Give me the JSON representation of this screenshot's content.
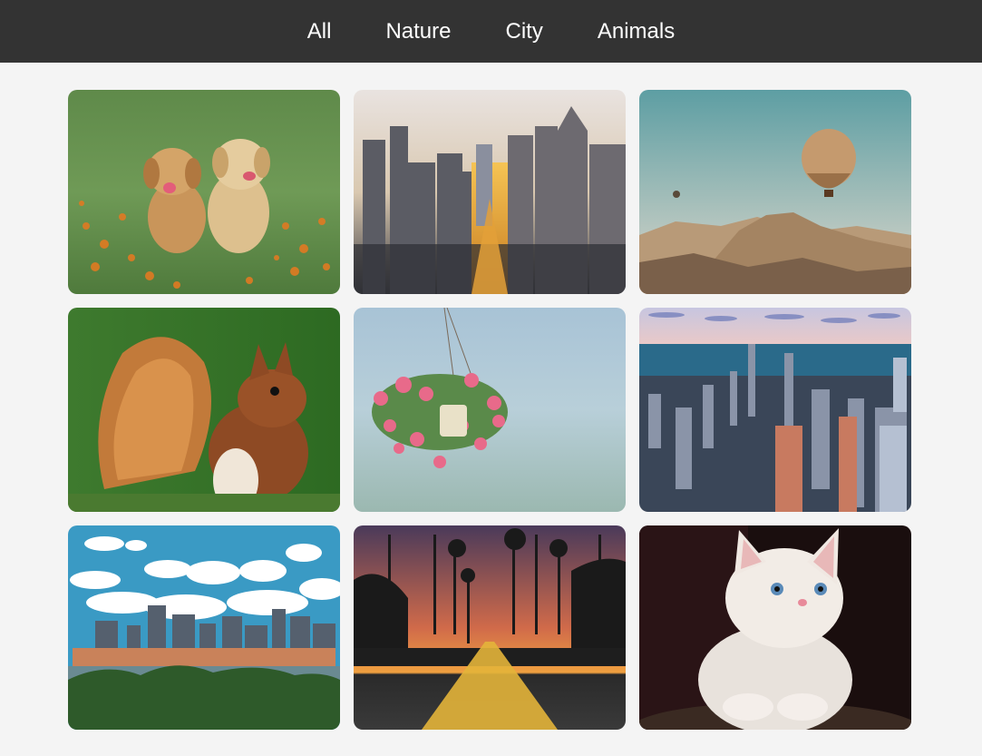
{
  "nav": {
    "filters": [
      {
        "label": "All"
      },
      {
        "label": "Nature"
      },
      {
        "label": "City"
      },
      {
        "label": "Animals"
      }
    ]
  },
  "gallery": {
    "items": [
      {
        "subject": "golden-retriever-puppies",
        "category": "Animals"
      },
      {
        "subject": "city-street-skyline-sunset",
        "category": "City"
      },
      {
        "subject": "hot-air-balloon-valley",
        "category": "Nature"
      },
      {
        "subject": "red-squirrel",
        "category": "Animals"
      },
      {
        "subject": "hanging-flower-basket",
        "category": "Nature"
      },
      {
        "subject": "aerial-city-coastline",
        "category": "City"
      },
      {
        "subject": "city-skyline-clouds",
        "category": "City"
      },
      {
        "subject": "palm-road-sunset",
        "category": "Nature"
      },
      {
        "subject": "white-kitten",
        "category": "Animals"
      }
    ]
  },
  "colors": {
    "header_bg": "#333333",
    "page_bg": "#f4f4f4",
    "nav_text": "#ffffff"
  }
}
